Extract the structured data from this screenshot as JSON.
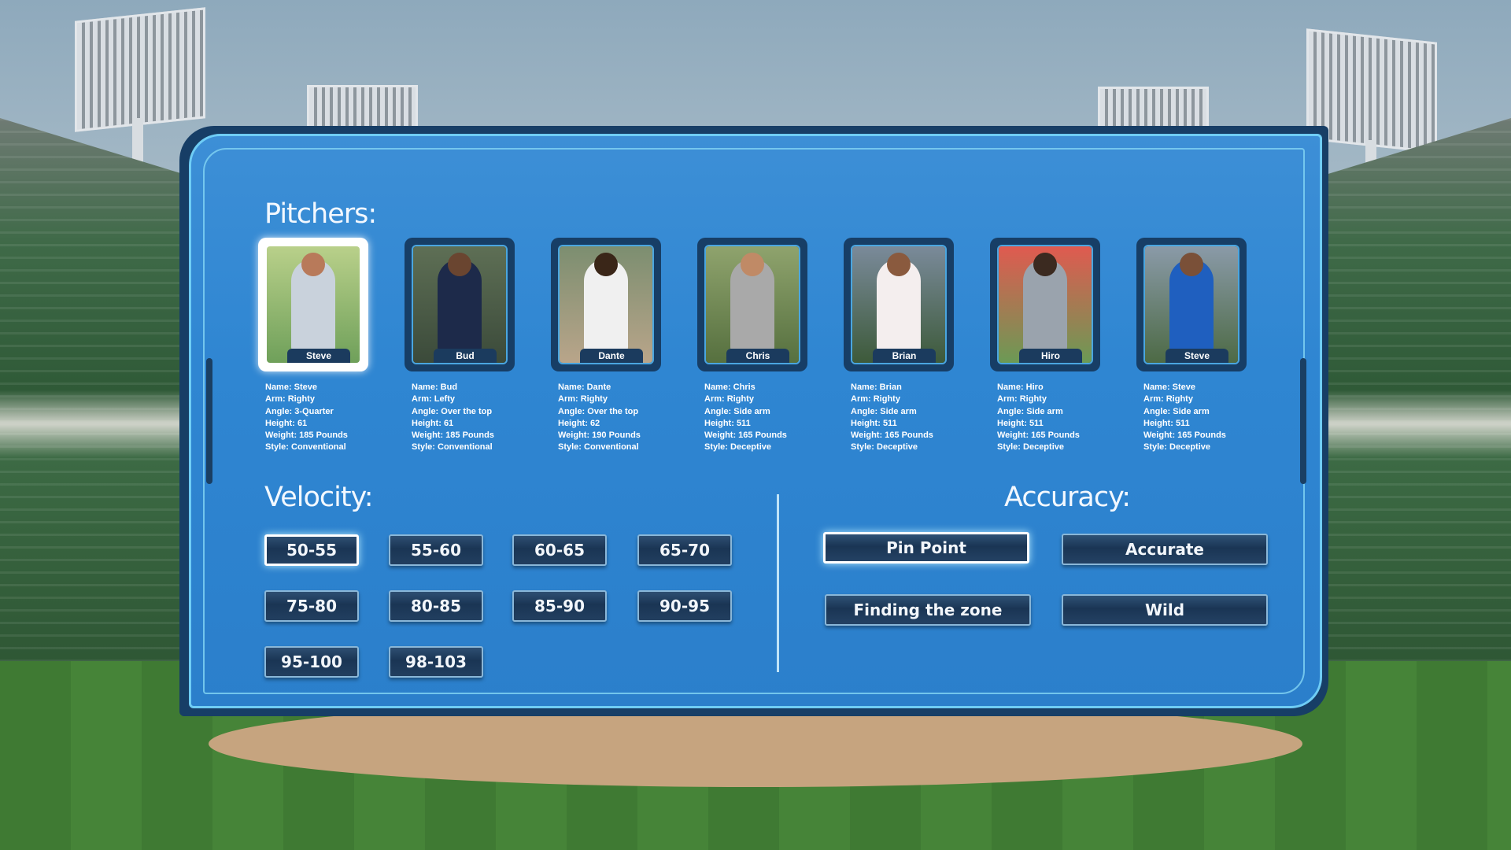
{
  "pitchers_title": "Pitchers:",
  "velocity_title": "Velocity:",
  "accuracy_title": "Accuracy:",
  "pitchers": [
    {
      "card_name": "Steve",
      "name": "Name: Steve",
      "arm": "Arm: Righty",
      "angle": "Angle: 3-Quarter",
      "height": "Height: 61",
      "weight": "Weight: 185 Pounds",
      "style": "Style: Conventional",
      "selected": true
    },
    {
      "card_name": "Bud",
      "name": "Name: Bud",
      "arm": "Arm: Lefty",
      "angle": "Angle: Over the top",
      "height": "Height: 61",
      "weight": "Weight: 185 Pounds",
      "style": "Style: Conventional",
      "selected": false
    },
    {
      "card_name": "Dante",
      "name": "Name: Dante",
      "arm": "Arm: Righty",
      "angle": "Angle: Over the top",
      "height": "Height: 62",
      "weight": "Weight: 190 Pounds",
      "style": "Style: Conventional",
      "selected": false
    },
    {
      "card_name": "Chris",
      "name": "Name: Chris",
      "arm": "Arm: Righty",
      "angle": "Angle: Side arm",
      "height": "Height: 511",
      "weight": "Weight: 165 Pounds",
      "style": "Style: Deceptive",
      "selected": false
    },
    {
      "card_name": "Brian",
      "name": "Name: Brian",
      "arm": "Arm: Righty",
      "angle": "Angle: Side arm",
      "height": "Height: 511",
      "weight": "Weight: 165 Pounds",
      "style": "Style: Deceptive",
      "selected": false
    },
    {
      "card_name": "Hiro",
      "name": "Name: Hiro",
      "arm": "Arm: Righty",
      "angle": "Angle: Side arm",
      "height": "Height: 511",
      "weight": "Weight: 165 Pounds",
      "style": "Style: Deceptive",
      "selected": false
    },
    {
      "card_name": "Steve",
      "name": "Name: Steve",
      "arm": "Arm: Righty",
      "angle": "Angle: Side arm",
      "height": "Height: 511",
      "weight": "Weight: 165 Pounds",
      "style": "Style: Deceptive",
      "selected": false
    }
  ],
  "velocity_options": [
    "50-55",
    "55-60",
    "60-65",
    "65-70",
    "75-80",
    "80-85",
    "85-90",
    "90-95",
    "95-100",
    "98-103"
  ],
  "velocity_selected": "50-55",
  "accuracy_options": [
    "Pin Point",
    "Accurate",
    "Finding the zone",
    "Wild"
  ],
  "accuracy_selected": "Pin Point",
  "colors": {
    "panel": "#2f86d2",
    "frame": "#173e66",
    "button": "#1a3554",
    "highlight": "#ffffff"
  }
}
